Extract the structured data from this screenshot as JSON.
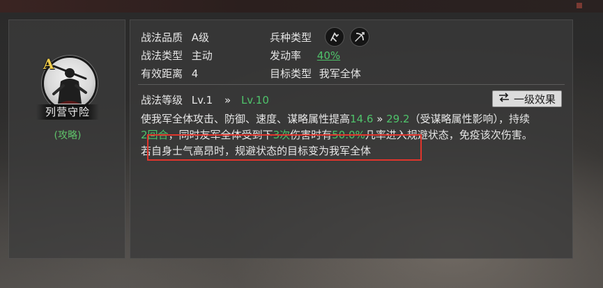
{
  "tactic": {
    "grade_letter": "A",
    "name": "列营守险",
    "strategy_link": "(攻略)"
  },
  "attributes": {
    "quality_label": "战法品质",
    "quality_value": "A级",
    "type_label": "战法类型",
    "type_value": "主动",
    "range_label": "有效距离",
    "range_value": "4",
    "troop_label": "兵种类型",
    "troop_icons": [
      "cavalry-icon",
      "archer-icon"
    ],
    "trigger_label": "发动率",
    "trigger_value": "40%",
    "target_label": "目标类型",
    "target_value": "我军全体"
  },
  "level": {
    "label": "战法等级",
    "current": "Lv.1",
    "arrow": "»",
    "max": "Lv.10",
    "effect_button_label": "一级效果"
  },
  "description": {
    "part1": "使我军全体攻击、防御、速度、谋略属性提高",
    "boost_min": "14.6",
    "arrow": " » ",
    "boost_max": "29.2",
    "part2": "（受谋略属性影响），持续",
    "duration": "2回合",
    "part3": "，同时友军全体受到下",
    "times": "3次",
    "part4": "伤害时有",
    "chance": "50.0%",
    "part5": "几率进入规避状态，免疫该次伤害。",
    "line3": "若自身士气高昂时，规避状态的目标变为我军全体"
  },
  "colors": {
    "highlight": "#4fc36b",
    "grade": "#f0cc4a",
    "annotation_box": "#e0352c"
  }
}
